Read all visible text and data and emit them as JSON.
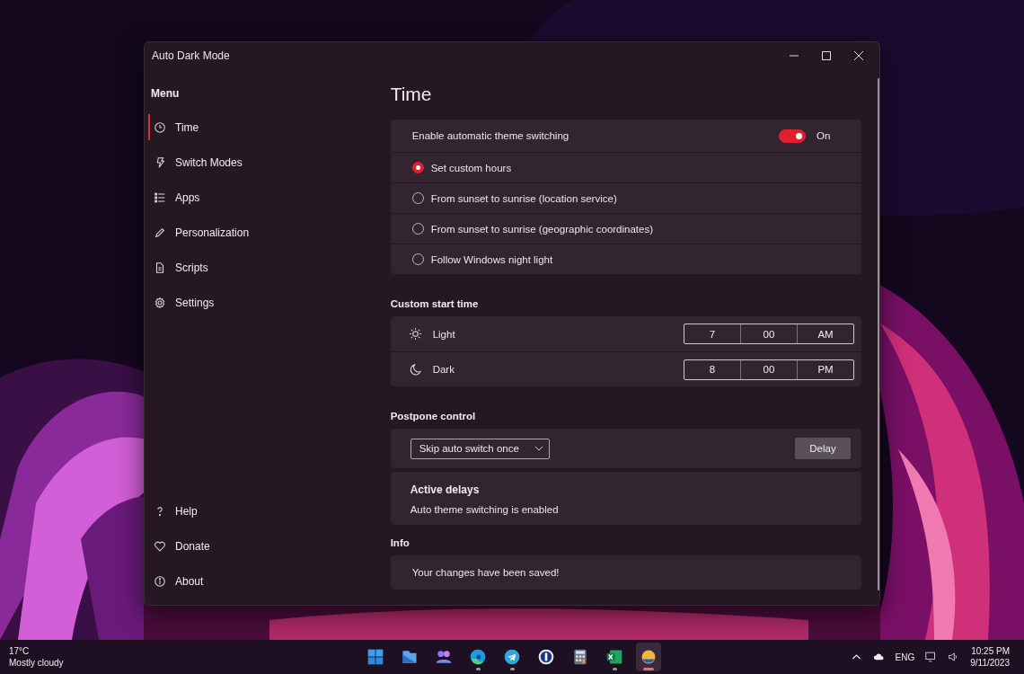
{
  "window": {
    "title": "Auto Dark Mode"
  },
  "sidebar": {
    "heading": "Menu",
    "items": [
      {
        "label": "Time",
        "kind": "clock",
        "selected": true
      },
      {
        "label": "Switch Modes",
        "kind": "bolt",
        "selected": false
      },
      {
        "label": "Apps",
        "kind": "list",
        "selected": false
      },
      {
        "label": "Personalization",
        "kind": "pen",
        "selected": false
      },
      {
        "label": "Scripts",
        "kind": "doc",
        "selected": false
      },
      {
        "label": "Settings",
        "kind": "gear",
        "selected": false
      }
    ],
    "footer_items": [
      {
        "label": "Help",
        "kind": "help",
        "selected": false
      },
      {
        "label": "Donate",
        "kind": "heart",
        "selected": false
      },
      {
        "label": "About",
        "kind": "info",
        "selected": false
      }
    ]
  },
  "page_title": "Time",
  "switching": {
    "label": "Enable automatic theme switching",
    "on": true,
    "state_label": "On",
    "options": [
      {
        "label": "Set custom hours",
        "selected": true
      },
      {
        "label": "From sunset to sunrise (location service)",
        "selected": false
      },
      {
        "label": "From sunset to sunrise (geographic coordinates)",
        "selected": false
      },
      {
        "label": "Follow Windows night light",
        "selected": false
      }
    ]
  },
  "custom_start_time": {
    "heading": "Custom start time",
    "rows": [
      {
        "kind": "sun",
        "label": "Light",
        "hour": "7",
        "minute": "00",
        "period": "AM"
      },
      {
        "kind": "moon",
        "label": "Dark",
        "hour": "8",
        "minute": "00",
        "period": "PM"
      }
    ]
  },
  "postpone": {
    "heading": "Postpone control",
    "dropdown": "Skip auto switch once",
    "button": "Delay",
    "active_title": "Active delays",
    "active_text": "Auto theme switching is enabled"
  },
  "info": {
    "heading": "Info",
    "message": "Your changes have been saved!"
  },
  "taskbar": {
    "weather": {
      "temperature": "17°C",
      "condition": "Mostly cloudy"
    },
    "apps": [
      {
        "kind": "start",
        "running": false,
        "active": false
      },
      {
        "kind": "files",
        "running": false,
        "active": false
      },
      {
        "kind": "people",
        "running": false,
        "active": false
      },
      {
        "kind": "edge",
        "running": true,
        "active": false
      },
      {
        "kind": "telegram",
        "running": true,
        "active": false
      },
      {
        "kind": "password",
        "running": false,
        "active": false
      },
      {
        "kind": "calculator",
        "running": false,
        "active": false
      },
      {
        "kind": "excel",
        "running": true,
        "active": false
      },
      {
        "kind": "darkmode",
        "running": true,
        "active": true
      }
    ],
    "language": "ENG",
    "time": "10:25 PM",
    "date": "9/11/2023"
  }
}
